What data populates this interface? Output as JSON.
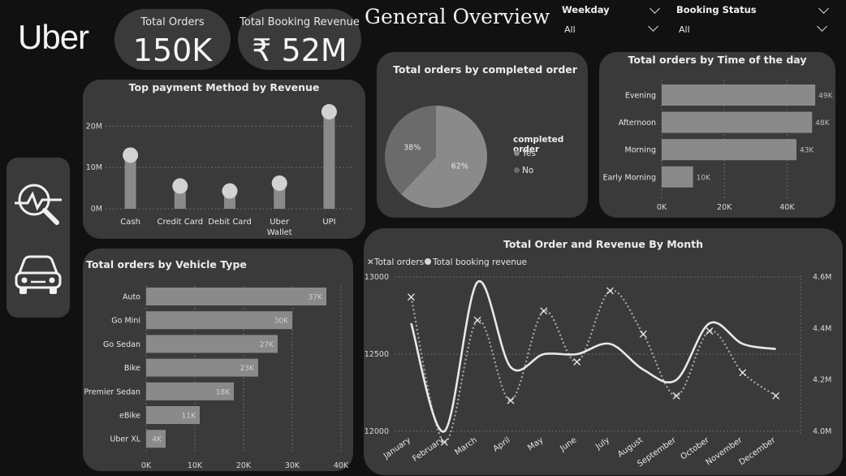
{
  "brand": {
    "logo_text": "Uber"
  },
  "page_title": "General Overview",
  "kpis": {
    "orders": {
      "label": "Total Orders",
      "value": "150K"
    },
    "revenue": {
      "label": "Total Booking Revenue",
      "value": "₹ 52M"
    }
  },
  "slicers": {
    "weekday": {
      "label": "Weekday",
      "value": "All"
    },
    "booking_status": {
      "label": "Booking Status",
      "value": "All"
    }
  },
  "nav_icons": [
    "analytics-search-icon",
    "car-icon"
  ],
  "colors": {
    "background": "#111111",
    "card": "#3a3a3a",
    "bar": "#8a8a8a",
    "line": "#e8e8e8",
    "dotted": "#a8a8a8"
  },
  "payment_chart": {
    "title": "Top payment Method by Revenue",
    "ticks": [
      "0M",
      "10M",
      "20M"
    ],
    "categories": [
      "Cash",
      "Credit Card",
      "Debit Card",
      "Uber Wallet",
      "UPI"
    ]
  },
  "completed_chart": {
    "title": "Total orders by completed order",
    "legend_title": "completed order",
    "legend": [
      "Yes",
      "No"
    ],
    "labels": [
      "62%",
      "38%"
    ]
  },
  "time_chart": {
    "title": "Total orders by Time of the day",
    "categories": [
      "Evening",
      "Afternoon",
      "Morning",
      "Early Morning"
    ],
    "labels": [
      "49K",
      "48K",
      "43K",
      "10K"
    ],
    "ticks": [
      "0K",
      "20K",
      "40K"
    ]
  },
  "vehicle_chart": {
    "title": "Total orders by Vehicle Type",
    "categories": [
      "Auto",
      "Go Mini",
      "Go Sedan",
      "Bike",
      "Premier Sedan",
      "eBike",
      "Uber XL"
    ],
    "labels": [
      "37K",
      "30K",
      "27K",
      "23K",
      "18K",
      "11K",
      "4K"
    ],
    "ticks": [
      "0K",
      "10K",
      "20K",
      "30K",
      "40K"
    ]
  },
  "month_chart": {
    "title": "Total Order and Revenue By Month",
    "legend": [
      "Total orders",
      "Total booking revenue"
    ],
    "left_ticks": [
      "12000",
      "12500",
      "13000"
    ],
    "right_ticks": [
      "4.0M",
      "4.2M",
      "4.4M",
      "4.6M"
    ],
    "months": [
      "January",
      "February",
      "March",
      "April",
      "May",
      "June",
      "July",
      "August",
      "September",
      "October",
      "November",
      "December"
    ]
  },
  "chart_data": [
    {
      "type": "bar",
      "title": "Top payment Method by Revenue",
      "categories": [
        "Cash",
        "Credit Card",
        "Debit Card",
        "Uber Wallet",
        "UPI"
      ],
      "values": [
        13.0,
        5.5,
        4.3,
        6.2,
        23.5
      ],
      "ylim": [
        0,
        25
      ],
      "unit": "M",
      "grid": true
    },
    {
      "type": "pie",
      "title": "Total orders by completed order",
      "categories": [
        "Yes",
        "No"
      ],
      "values": [
        62,
        38
      ]
    },
    {
      "type": "bar",
      "title": "Total orders by Time of the day",
      "categories": [
        "Evening",
        "Afternoon",
        "Morning",
        "Early Morning"
      ],
      "values": [
        49,
        48,
        43,
        10
      ],
      "xlim": [
        0,
        50
      ],
      "unit": "K"
    },
    {
      "type": "bar",
      "title": "Total orders by Vehicle Type",
      "categories": [
        "Auto",
        "Go Mini",
        "Go Sedan",
        "Bike",
        "Premier Sedan",
        "eBike",
        "Uber XL"
      ],
      "values": [
        37,
        30,
        27,
        23,
        18,
        11,
        4
      ],
      "xlim": [
        0,
        40
      ],
      "unit": "K"
    },
    {
      "type": "line",
      "title": "Total Order and Revenue By Month",
      "x": [
        "January",
        "February",
        "March",
        "April",
        "May",
        "June",
        "July",
        "August",
        "September",
        "October",
        "November",
        "December"
      ],
      "series": [
        {
          "name": "Total orders",
          "axis": "left",
          "values": [
            12870,
            11930,
            12720,
            12200,
            12780,
            12450,
            12910,
            12630,
            12230,
            12650,
            12380,
            12230
          ]
        },
        {
          "name": "Total booking revenue",
          "axis": "right",
          "values": [
            4420000,
            4000000,
            4580000,
            4250000,
            4300000,
            4300000,
            4340000,
            4240000,
            4200000,
            4420000,
            4340000,
            4320000
          ]
        }
      ],
      "ylim_left": [
        12000,
        13000
      ],
      "ylim_right": [
        4000000,
        4600000
      ],
      "grid": true
    }
  ]
}
